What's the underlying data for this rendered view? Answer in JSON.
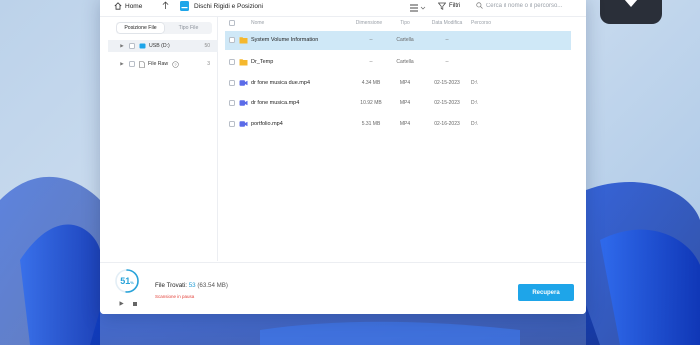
{
  "colors": {
    "accent": "#1ea5e9",
    "selected_row": "#cfe8f7",
    "folder": "#f5b82e",
    "video": "#5b6be8",
    "status_red": "#e3423a"
  },
  "topbar": {
    "home_label": "Home",
    "path_label": "Dischi Rigidi e Posizioni",
    "filter_label": "Filtri",
    "search_placeholder": "Cerca il nome o il percorso...",
    "icons": [
      "home-icon",
      "arrow-up-icon",
      "drive-icon",
      "list-view-icon",
      "filter-icon",
      "search-icon"
    ]
  },
  "sidebar": {
    "tabs": [
      {
        "label": "Posizione File",
        "active": true
      },
      {
        "label": "Tipo File",
        "active": false
      }
    ],
    "items": [
      {
        "label": "USB (D:)",
        "count": "50",
        "icon": "usb-drive-icon"
      },
      {
        "label": "File Raw",
        "count": "3",
        "icon": "help-circle-icon"
      }
    ]
  },
  "table": {
    "columns": [
      "Nome",
      "Dimensione",
      "Tipo",
      "Data Modifica",
      "Percorso"
    ],
    "rows": [
      {
        "name": "System Volume Information",
        "size": "--",
        "type": "Cartella",
        "date": "--",
        "path": "",
        "icon": "folder-icon"
      },
      {
        "name": "Dr_Temp",
        "size": "--",
        "type": "Cartella",
        "date": "--",
        "path": "",
        "icon": "folder-icon"
      },
      {
        "name": "dr fone musica due.mp4",
        "size": "4.34 MB",
        "type": "MP4",
        "date": "02-15-2023",
        "path": "D:\\",
        "icon": "video-file-icon"
      },
      {
        "name": "dr fone musica.mp4",
        "size": "10.92 MB",
        "type": "MP4",
        "date": "02-15-2023",
        "path": "D:\\",
        "icon": "video-file-icon"
      },
      {
        "name": "portfolio.mp4",
        "size": "5.31 MB",
        "type": "MP4",
        "date": "02-16-2023",
        "path": "D:\\",
        "icon": "video-file-icon"
      }
    ]
  },
  "footer": {
    "progress": 51,
    "progress_value": "51",
    "progress_unit": "%",
    "found_label": "File Trovati:",
    "found_count": "53",
    "found_size": "(63.54 MB)",
    "status": "Scansione in pausa",
    "recover_label": "Recupera"
  }
}
